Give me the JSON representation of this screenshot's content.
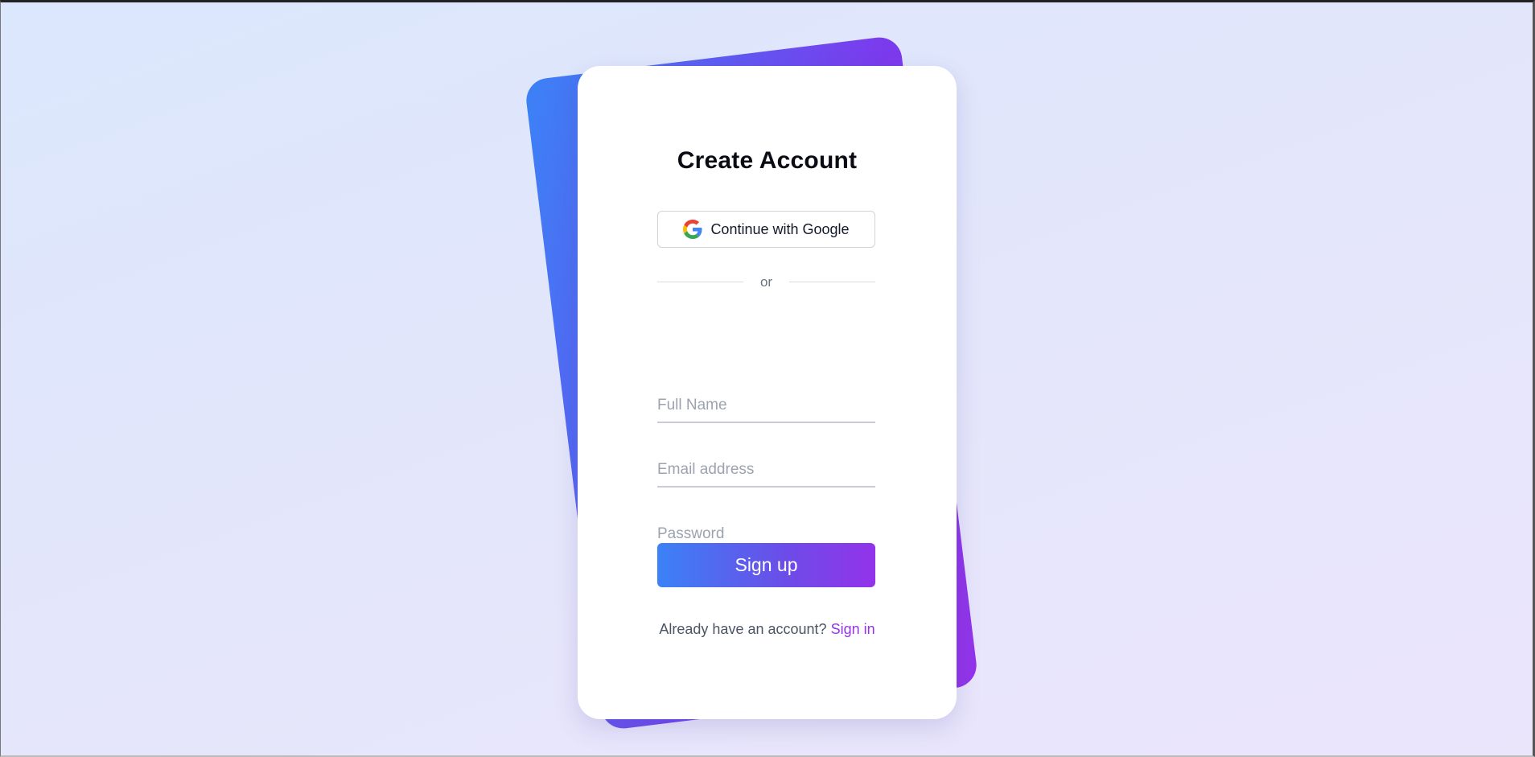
{
  "form": {
    "title": "Create Account",
    "google_button_label": "Continue with Google",
    "divider_text": "or",
    "full_name_placeholder": "Full Name",
    "email_placeholder": "Email address",
    "password_placeholder": "Password",
    "signup_label": "Sign up",
    "footer_prompt": "Already have an account?",
    "signin_label": "Sign in"
  },
  "colors": {
    "accent_start": "#3b82f6",
    "accent_end": "#9333ea",
    "link": "#9333ea",
    "background": "#e3e6fb"
  },
  "icons": {
    "google": "google-g-icon"
  }
}
